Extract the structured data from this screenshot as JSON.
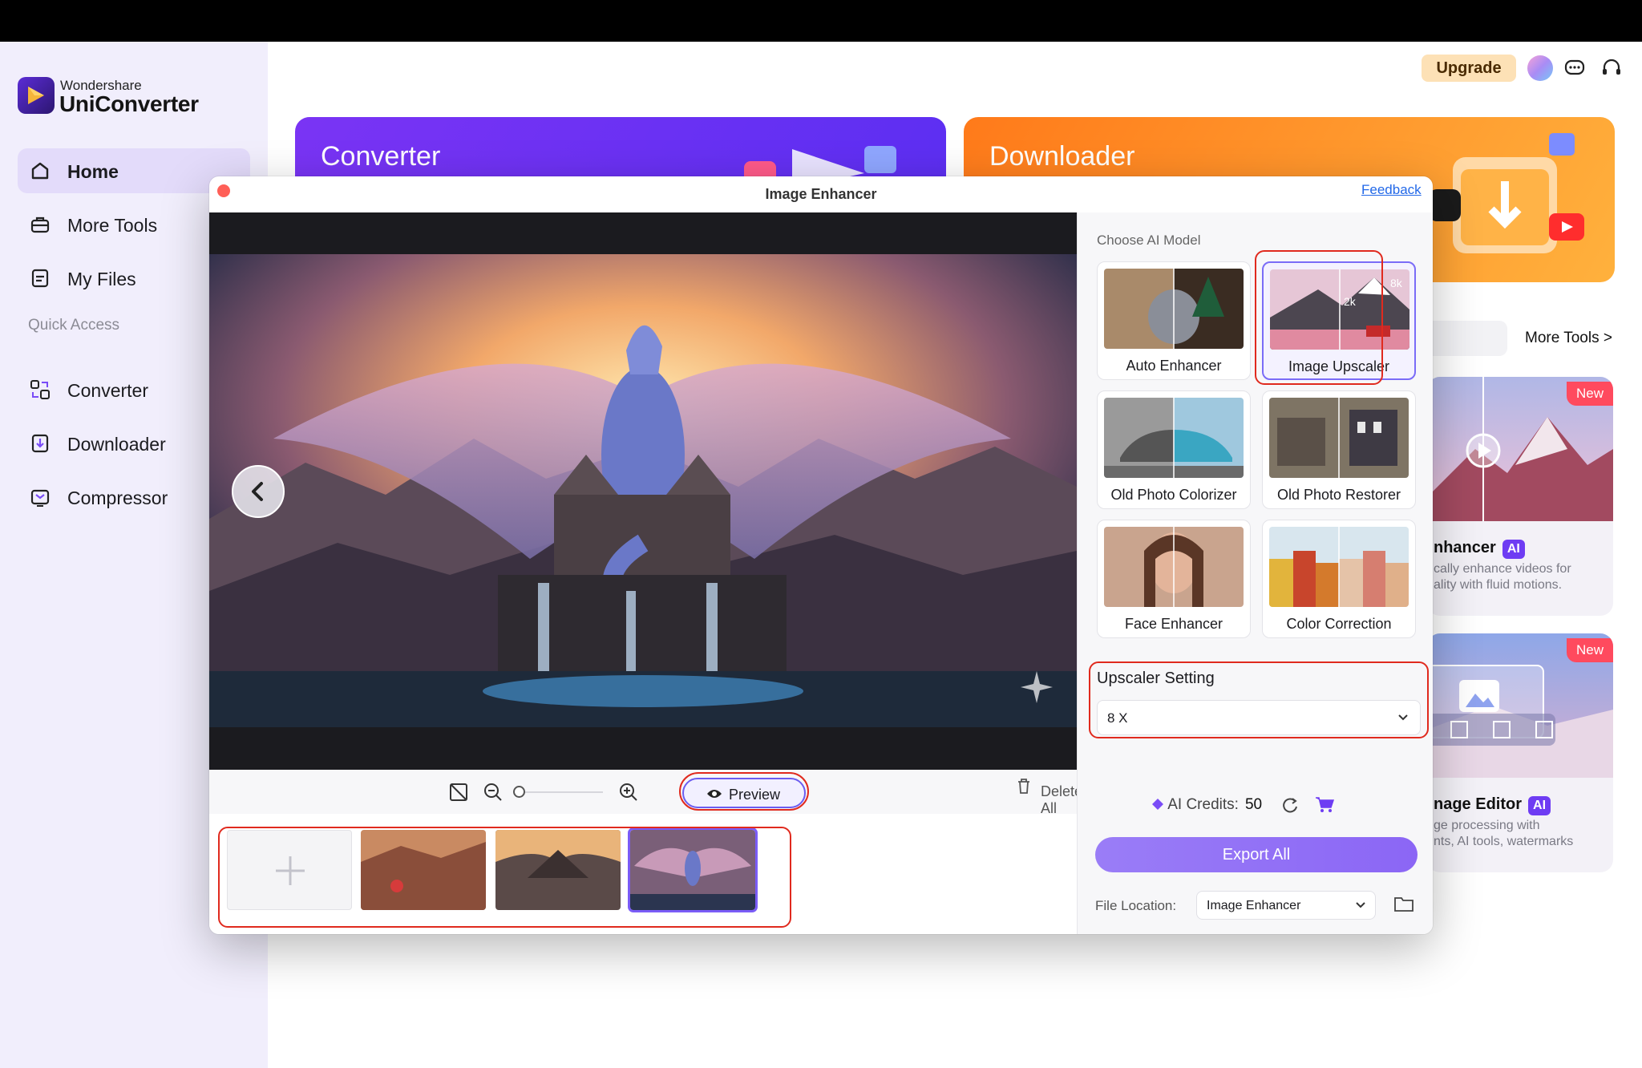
{
  "app": {
    "brand_small": "Wondershare",
    "brand_name": "UniConverter"
  },
  "sidebar": {
    "items": [
      {
        "label": "Home",
        "icon": "home-icon"
      },
      {
        "label": "More Tools",
        "icon": "toolbox-icon"
      },
      {
        "label": "My Files",
        "icon": "files-icon"
      }
    ],
    "quick_access_label": "Quick Access",
    "quick_items": [
      {
        "label": "Converter",
        "icon": "converter-icon"
      },
      {
        "label": "Downloader",
        "icon": "downloader-icon"
      },
      {
        "label": "Compressor",
        "icon": "compressor-icon"
      }
    ]
  },
  "header": {
    "upgrade_label": "Upgrade"
  },
  "home": {
    "converter_title": "Converter",
    "downloader_title": "Downloader",
    "more_tools_link": "More Tools >",
    "tool_cards": [
      {
        "badge": "New",
        "title": "nhancer",
        "ai": "AI",
        "desc1": "cally enhance videos for",
        "desc2": "ality with fluid motions."
      },
      {
        "badge": "New",
        "title": "nage Editor",
        "ai": "AI",
        "desc1": "ge processing with",
        "desc2": "nts, AI tools, watermarks"
      }
    ]
  },
  "dialog": {
    "title": "Image Enhancer",
    "feedback_label": "Feedback",
    "toolbar": {
      "preview_label": "Preview",
      "delete_all_label": "Delete All",
      "zoom_level": 0
    },
    "right_panel": {
      "choose_label": "Choose AI Model",
      "models": [
        {
          "label": "Auto Enhancer"
        },
        {
          "label": "Image Upscaler",
          "selected": true,
          "tag_left": "2k",
          "tag_right": "8k"
        },
        {
          "label": "Old Photo Colorizer"
        },
        {
          "label": "Old Photo Restorer"
        },
        {
          "label": "Face Enhancer"
        },
        {
          "label": "Color Correction"
        }
      ],
      "setting_label": "Upscaler Setting",
      "setting_value": "8 X",
      "credits_label": "AI Credits:",
      "credits_value": "50",
      "export_label": "Export All",
      "file_location_label": "File Location:",
      "file_location_value": "Image Enhancer"
    }
  },
  "colors": {
    "accent": "#8b66f5",
    "highlight": "#e02a1e",
    "converter": "#6c32f3",
    "downloader": "#ff8a22"
  }
}
